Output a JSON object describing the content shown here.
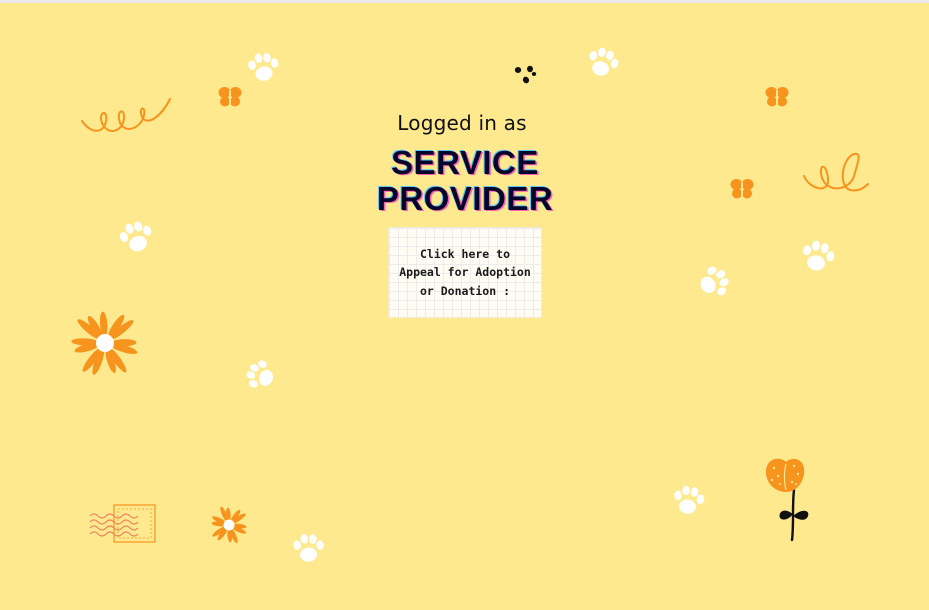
{
  "session": {
    "logged_in_label": "Logged in as",
    "role_line_1": "SERVICE",
    "role_line_2": "PROVIDER"
  },
  "appeal_card": {
    "line_1": "Click here to",
    "line_2": "Appeal for Adoption",
    "line_3": "or Donation :"
  },
  "colors": {
    "background": "#ffe98f",
    "accent_orange": "#f7941d",
    "paw_white": "#ffffff",
    "title_text": "#05052a"
  },
  "decorations": {
    "icons": [
      "paw-print-icon",
      "butterfly-icon",
      "daisy-flower-icon",
      "squiggle-icon",
      "tulip-flower-icon",
      "postcard-stamp-icon",
      "ink-dots-icon"
    ]
  }
}
